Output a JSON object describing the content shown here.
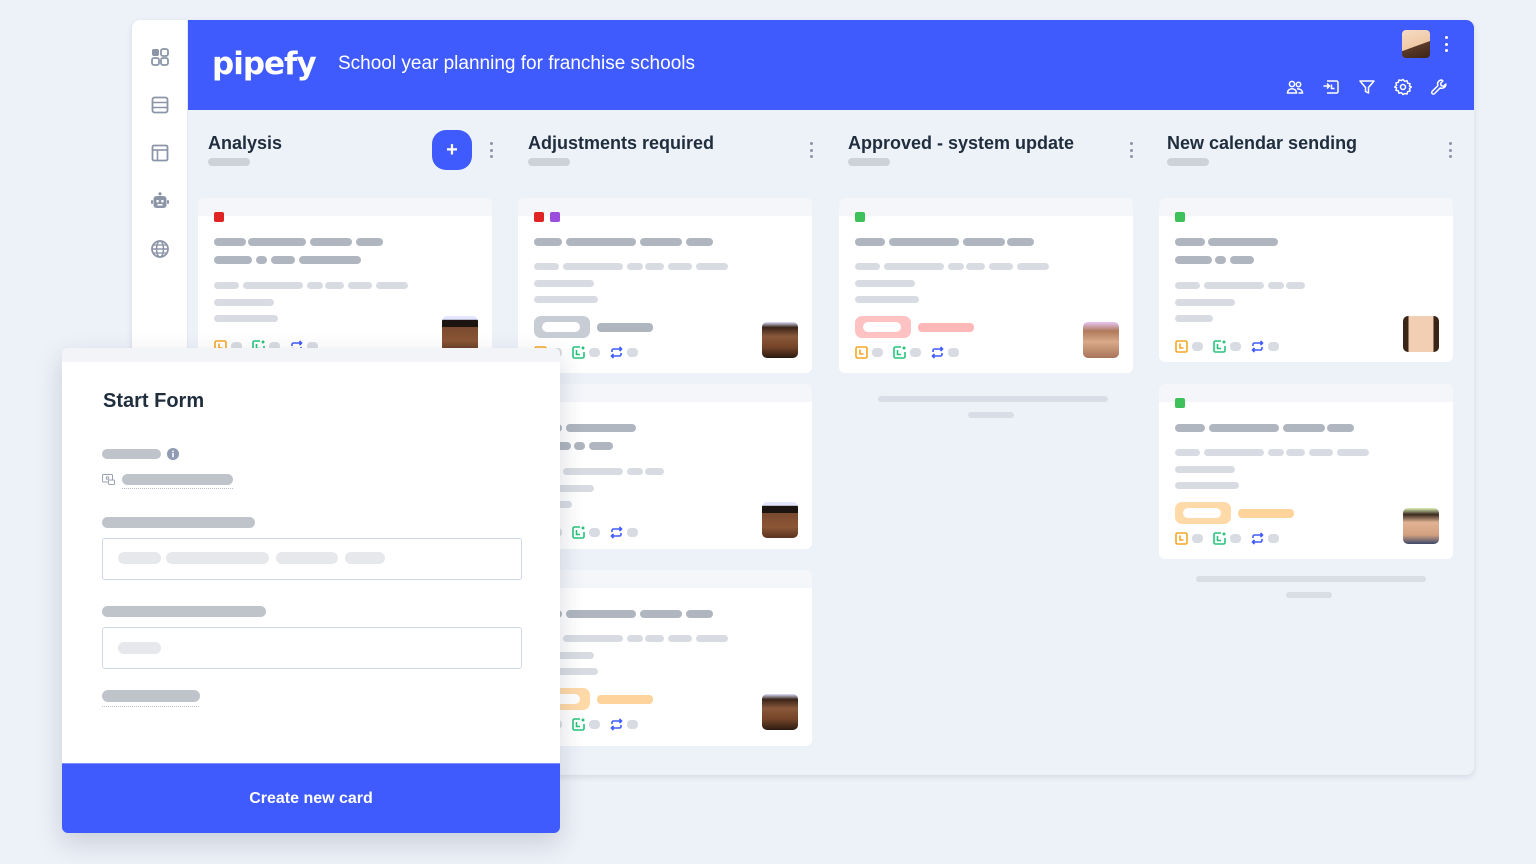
{
  "app": {
    "logo": "pipefy",
    "pipe_title": "School year planning for franchise schools",
    "accent_color": "#3f5bfd"
  },
  "sidebar": {
    "items": [
      {
        "icon": "apps-grid-icon"
      },
      {
        "icon": "database-table-icon"
      },
      {
        "icon": "layout-panel-icon"
      },
      {
        "icon": "robot-automation-icon"
      },
      {
        "icon": "globe-portal-icon"
      }
    ]
  },
  "header": {
    "tools": [
      {
        "icon": "members-icon"
      },
      {
        "icon": "import-report-icon"
      },
      {
        "icon": "filter-icon"
      },
      {
        "icon": "settings-gear-icon"
      },
      {
        "icon": "wrench-icon"
      }
    ],
    "user_avatar": "user-avatar",
    "more_menu": "more-vertical-icon"
  },
  "phases": [
    {
      "title": "Analysis",
      "has_add_button": true,
      "add_label": "+"
    },
    {
      "title": "Adjustments required"
    },
    {
      "title": "Approved - system update"
    },
    {
      "title": "New calendar sending"
    }
  ],
  "card_tag_colors": {
    "red": "#e02424",
    "purple": "#9b4dde",
    "green": "#3ec05a"
  },
  "card_icons": [
    "clock-icon",
    "due-date-icon",
    "repeat-icon"
  ],
  "start_form": {
    "title": "Start Form",
    "info_icon": "info-icon",
    "submit_label": "Create new card"
  }
}
